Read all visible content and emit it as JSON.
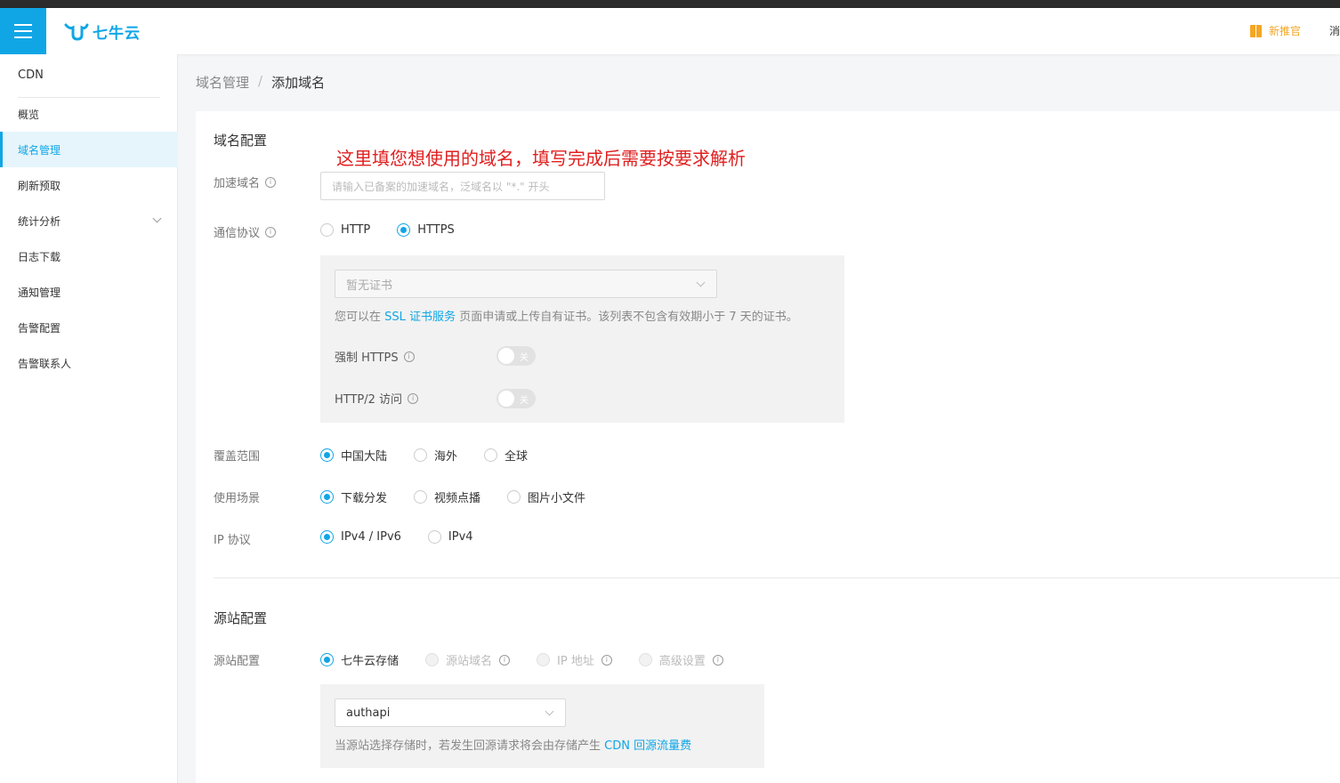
{
  "header": {
    "brand": "七牛云",
    "promo_label": "新推官",
    "messages_label": "消息"
  },
  "sidebar": {
    "title": "CDN",
    "items": [
      {
        "label": "概览"
      },
      {
        "label": "域名管理"
      },
      {
        "label": "刷新预取"
      },
      {
        "label": "统计分析"
      },
      {
        "label": "日志下载"
      },
      {
        "label": "通知管理"
      },
      {
        "label": "告警配置"
      },
      {
        "label": "告警联系人"
      }
    ],
    "active_index": 1
  },
  "breadcrumb": {
    "parent": "域名管理",
    "separator": "/",
    "current": "添加域名"
  },
  "domain_config": {
    "title": "域名配置",
    "annotation": "这里填您想使用的域名，填写完成后需要按要求解析",
    "domain_label": "加速域名",
    "domain_placeholder": "请输入已备案的加速域名，泛域名以 \"*.\" 开头",
    "protocol_label": "通信协议",
    "protocol_options": [
      "HTTP",
      "HTTPS"
    ],
    "protocol_selected": "HTTPS",
    "cert_select_value": "暂无证书",
    "cert_hint_prefix": "您可以在",
    "cert_hint_link": "SSL 证书服务",
    "cert_hint_suffix": "页面申请或上传自有证书。该列表不包含有效期小于 7 天的证书。",
    "force_https_label": "强制 HTTPS",
    "force_https_state": "关",
    "http2_label": "HTTP/2 访问",
    "http2_state": "关",
    "coverage_label": "覆盖范围",
    "coverage_options": [
      "中国大陆",
      "海外",
      "全球"
    ],
    "coverage_selected": "中国大陆",
    "scene_label": "使用场景",
    "scene_options": [
      "下载分发",
      "视频点播",
      "图片小文件"
    ],
    "scene_selected": "下载分发",
    "ip_label": "IP 协议",
    "ip_options": [
      "IPv4 / IPv6",
      "IPv4"
    ],
    "ip_selected": "IPv4 / IPv6"
  },
  "origin_config": {
    "title": "源站配置",
    "origin_label": "源站配置",
    "origin_options": [
      "七牛云存储",
      "源站域名",
      "IP 地址",
      "高级设置"
    ],
    "origin_selected": "七牛云存储",
    "bucket_value": "authapi",
    "bucket_hint_prefix": "当源站选择存储时，若发生回源请求将会由存储产生",
    "bucket_hint_link": "CDN 回源流量费"
  },
  "colors": {
    "accent": "#10a6e6",
    "annotation": "#e02020",
    "promo": "#f5a623"
  }
}
